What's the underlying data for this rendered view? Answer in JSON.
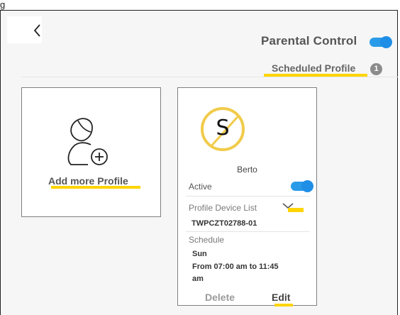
{
  "caption": "g",
  "header": {
    "back_icon": "chevron-left-icon",
    "title": "Parental Control",
    "toggle_on": true,
    "subtitle": "Scheduled Profile",
    "count": "1"
  },
  "add_card": {
    "icon": "add-user-icon",
    "label": "Add more Profile"
  },
  "profile_card": {
    "avatar_letter": "S",
    "name": "Berto",
    "active_label": "Active",
    "active_on": true,
    "device_list_label": "Profile Device List",
    "device_name": "TWPCZT02788-01",
    "schedule_label": "Schedule",
    "schedule_day": "Sun",
    "schedule_time_line1": "From 07:00 am to 11:45",
    "schedule_time_line2": "am",
    "delete_label": "Delete",
    "edit_label": "Edit"
  },
  "colors": {
    "accent": "#1f8ee6",
    "highlight": "#ffd400",
    "avatar_ring": "#f1cb4a"
  }
}
